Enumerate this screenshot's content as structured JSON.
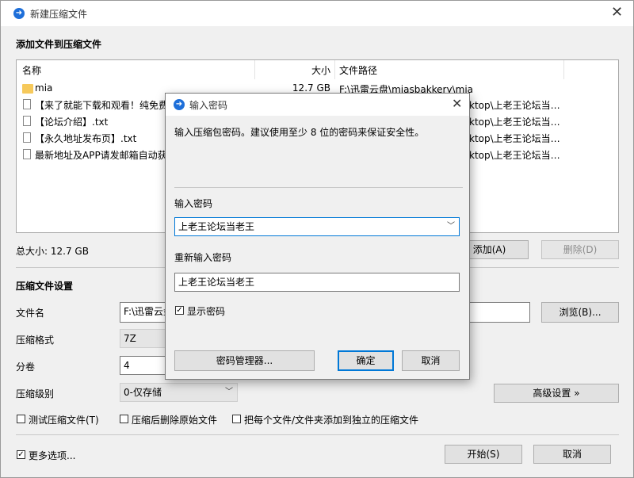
{
  "main_window": {
    "title": "新建压缩文件",
    "section_add": "添加文件到压缩文件",
    "list": {
      "headers": {
        "name": "名称",
        "size": "大小",
        "path": "文件路径"
      },
      "rows": [
        {
          "type": "folder",
          "name": "mia",
          "size": "12.7 GB",
          "path": "F:\\迅雷云盘\\miasbakkery\\mia"
        },
        {
          "type": "file",
          "name": "【来了就能下载和观看！纯免费",
          "size": "",
          "path": "ktop\\上老王论坛当…"
        },
        {
          "type": "file",
          "name": "【论坛介绍】.txt",
          "size": "",
          "path": "ktop\\上老王论坛当…"
        },
        {
          "type": "file",
          "name": "【永久地址发布页】.txt",
          "size": "",
          "path": "ktop\\上老王论坛当…"
        },
        {
          "type": "file",
          "name": "最新地址及APP请发邮箱自动获",
          "size": "",
          "path": "ktop\\上老王论坛当…"
        }
      ]
    },
    "total_size": "总大小: 12.7 GB",
    "add_button": "添加(A)",
    "delete_button": "删除(D)",
    "section_settings": "压缩文件设置",
    "filename_label": "文件名",
    "filename_value": "F:\\迅雷云盘",
    "browse_button": "浏览(B)...",
    "format_label": "压缩格式",
    "format_value": "7Z",
    "volume_label": "分卷",
    "volume_value": "4",
    "level_label": "压缩级别",
    "level_value": "0-仅存储",
    "advanced_button": "高级设置 »",
    "opt_test": "测试压缩文件(T)",
    "opt_delete": "压缩后删除原始文件",
    "opt_each": "把每个文件/文件夹添加到独立的压缩文件",
    "more_options": "更多选项...",
    "start_button": "开始(S)",
    "cancel_button": "取消"
  },
  "dialog": {
    "title": "输入密码",
    "description": "输入压缩包密码。建议使用至少 8 位的密码来保证安全性。",
    "password_label": "输入密码",
    "password_value": "上老王论坛当老王",
    "repeat_label": "重新输入密码",
    "repeat_value": "上老王论坛当老王",
    "show_password": "显示密码",
    "manager_button": "密码管理器...",
    "ok_button": "确定",
    "cancel_button": "取消"
  },
  "colors": {
    "accent": "#0078d7",
    "app_icon": "#1e6fd9",
    "folder": "#f6c95b"
  }
}
